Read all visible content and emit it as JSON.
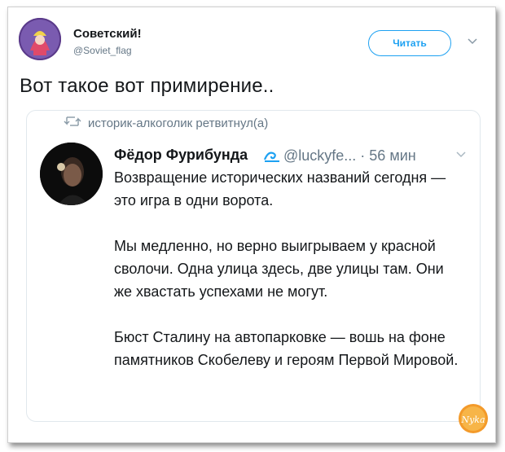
{
  "tweet": {
    "author_name": "Советский!",
    "author_handle": "@Soviet_flag",
    "follow_label": "Читать",
    "text": "Вот такое вот примирение.."
  },
  "quote": {
    "retweet_line": "историк-алкоголик ретвитнул(а)",
    "author_name": "Фёдор Фурибунда",
    "author_handle": "@luckyfe... · 56 мин",
    "paragraphs": [
      "Возвращение исторических названий сегодня — это игра в одни ворота.",
      "Мы медленно, но верно выигрываем у красной сволочи. Одна улица здесь, две улицы там. Они же хвастать успехами не могут.",
      "Бюст Сталину на автопарковке — вошь на фоне памятников Скобелеву и героям Первой Мировой."
    ]
  },
  "watermark": {
    "text": "Nyka"
  },
  "colors": {
    "accent": "#1da1f2",
    "muted": "#657786",
    "text": "#14171a",
    "border": "#e1e8ed"
  },
  "icons": [
    "avatar-icon",
    "chevron-down-icon",
    "retweet-icon",
    "wave-emoji-icon",
    "logo-icon"
  ]
}
